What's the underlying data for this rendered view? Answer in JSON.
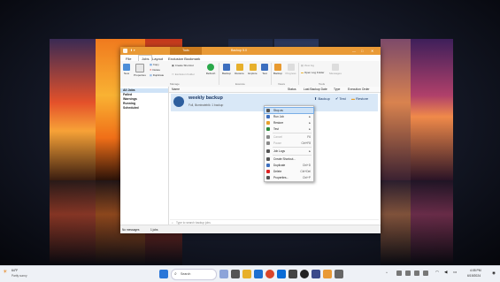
{
  "window": {
    "title": "Backup 5.0",
    "active_tab": "Tools",
    "controls": {
      "minimize": "—",
      "maximize": "□",
      "close": "✕"
    }
  },
  "menubar": {
    "items": [
      "File",
      "Jobs",
      "Layout",
      "Exclusion Bookmark"
    ],
    "active": "Jobs"
  },
  "ribbon": {
    "buttons": {
      "new": "New",
      "properties": "Properties",
      "copy": "Copy",
      "delete": "Delete",
      "duplicate": "Duplicate",
      "create_shortcut": "Create Shortcut",
      "exclusion_folder": "Exclusion Folder",
      "refresh": "Refresh",
      "backup": "Backup",
      "restore": "Restore",
      "explore": "Explore",
      "test": "Test",
      "backup2": "Backup",
      "progress": "Progress",
      "view_log": "View log",
      "open_log_folder": "Open Log Folder",
      "messages": "Messages"
    },
    "groups": {
      "manage": "Manage",
      "execute": "Execute",
      "views": "Views",
      "tools": "Tools"
    }
  },
  "sidebar": {
    "items": [
      "All Jobs",
      "Failed",
      "Warnings",
      "Running",
      "Scheduled"
    ]
  },
  "table": {
    "columns": [
      "Name",
      "Status",
      "Last Backup Date",
      "Type",
      "Execution Order"
    ]
  },
  "job": {
    "name": "weekly backup",
    "subtitle": "Full, Illuminateblk: 1 backup",
    "actions": {
      "backup": "Backup",
      "test": "Test",
      "restore": "Restore"
    }
  },
  "search": {
    "placeholder": "Type to search backup jobs"
  },
  "statusbar": {
    "left": "No messages",
    "right": "1 jobs"
  },
  "context_menu": {
    "items": [
      {
        "label": "Stop as",
        "shortcut": "",
        "submenu": false,
        "disabled": false,
        "highlighted": true
      },
      {
        "label": "Run Job",
        "shortcut": "",
        "submenu": true,
        "disabled": false
      },
      {
        "label": "Restore",
        "shortcut": "",
        "submenu": true,
        "disabled": false
      },
      {
        "label": "Test",
        "shortcut": "",
        "submenu": true,
        "disabled": false
      },
      {
        "label": "Cancel",
        "shortcut": "F6",
        "submenu": false,
        "disabled": true
      },
      {
        "label": "Pause",
        "shortcut": "Ctrl+F8",
        "submenu": false,
        "disabled": true
      },
      {
        "label": "Job Logs",
        "shortcut": "",
        "submenu": true,
        "disabled": false
      },
      {
        "label": "Create Shortcut...",
        "shortcut": "",
        "submenu": false,
        "disabled": false
      },
      {
        "label": "Duplicate",
        "shortcut": "Ctrl+D",
        "submenu": false,
        "disabled": false
      },
      {
        "label": "Delete",
        "shortcut": "Ctrl+Del",
        "submenu": false,
        "disabled": false
      },
      {
        "label": "Properties...",
        "shortcut": "Ctrl+P",
        "submenu": false,
        "disabled": false
      }
    ]
  },
  "taskbar": {
    "weather_temp": "64°F",
    "weather_desc": "Partly sunny",
    "search_label": "Search",
    "time": "4:05 PM",
    "date": "6/19/2024"
  },
  "colors": {
    "title_orange": "#e99a36",
    "selection_blue": "#d9e8f7",
    "taskbar_bg": "#eef1f6"
  }
}
